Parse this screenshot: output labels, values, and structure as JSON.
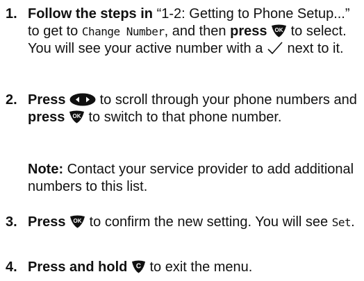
{
  "steps": [
    {
      "number": "1.",
      "lead": "Follow the steps in",
      "quote": "“1-2: Getting to Phone Setup...”",
      "t1": "to get to",
      "lcd": "Change Number",
      "t2": ", and then",
      "press": "press",
      "t3": "to select. You will see your active number with a",
      "t4": "next to it.",
      "icons": [
        "ok-key-icon",
        "checkmark-icon"
      ]
    },
    {
      "number": "2.",
      "lead": "Press",
      "t1": "to scroll through your phone numbers and",
      "press": "press",
      "t2": "to switch to that phone number.",
      "icons": [
        "navigation-key-icon",
        "ok-key-icon"
      ]
    },
    {
      "note_label": "Note:",
      "note_text": "Contact your service provider to add additional numbers to this list."
    },
    {
      "number": "3.",
      "lead": "Press",
      "t1": "to confirm the new setting. You will see",
      "lcd": "Set",
      "t2": ".",
      "icons": [
        "ok-key-icon"
      ]
    },
    {
      "number": "4.",
      "lead": "Press and hold",
      "t1": "to exit the menu.",
      "icons": [
        "clear-key-icon"
      ]
    }
  ]
}
